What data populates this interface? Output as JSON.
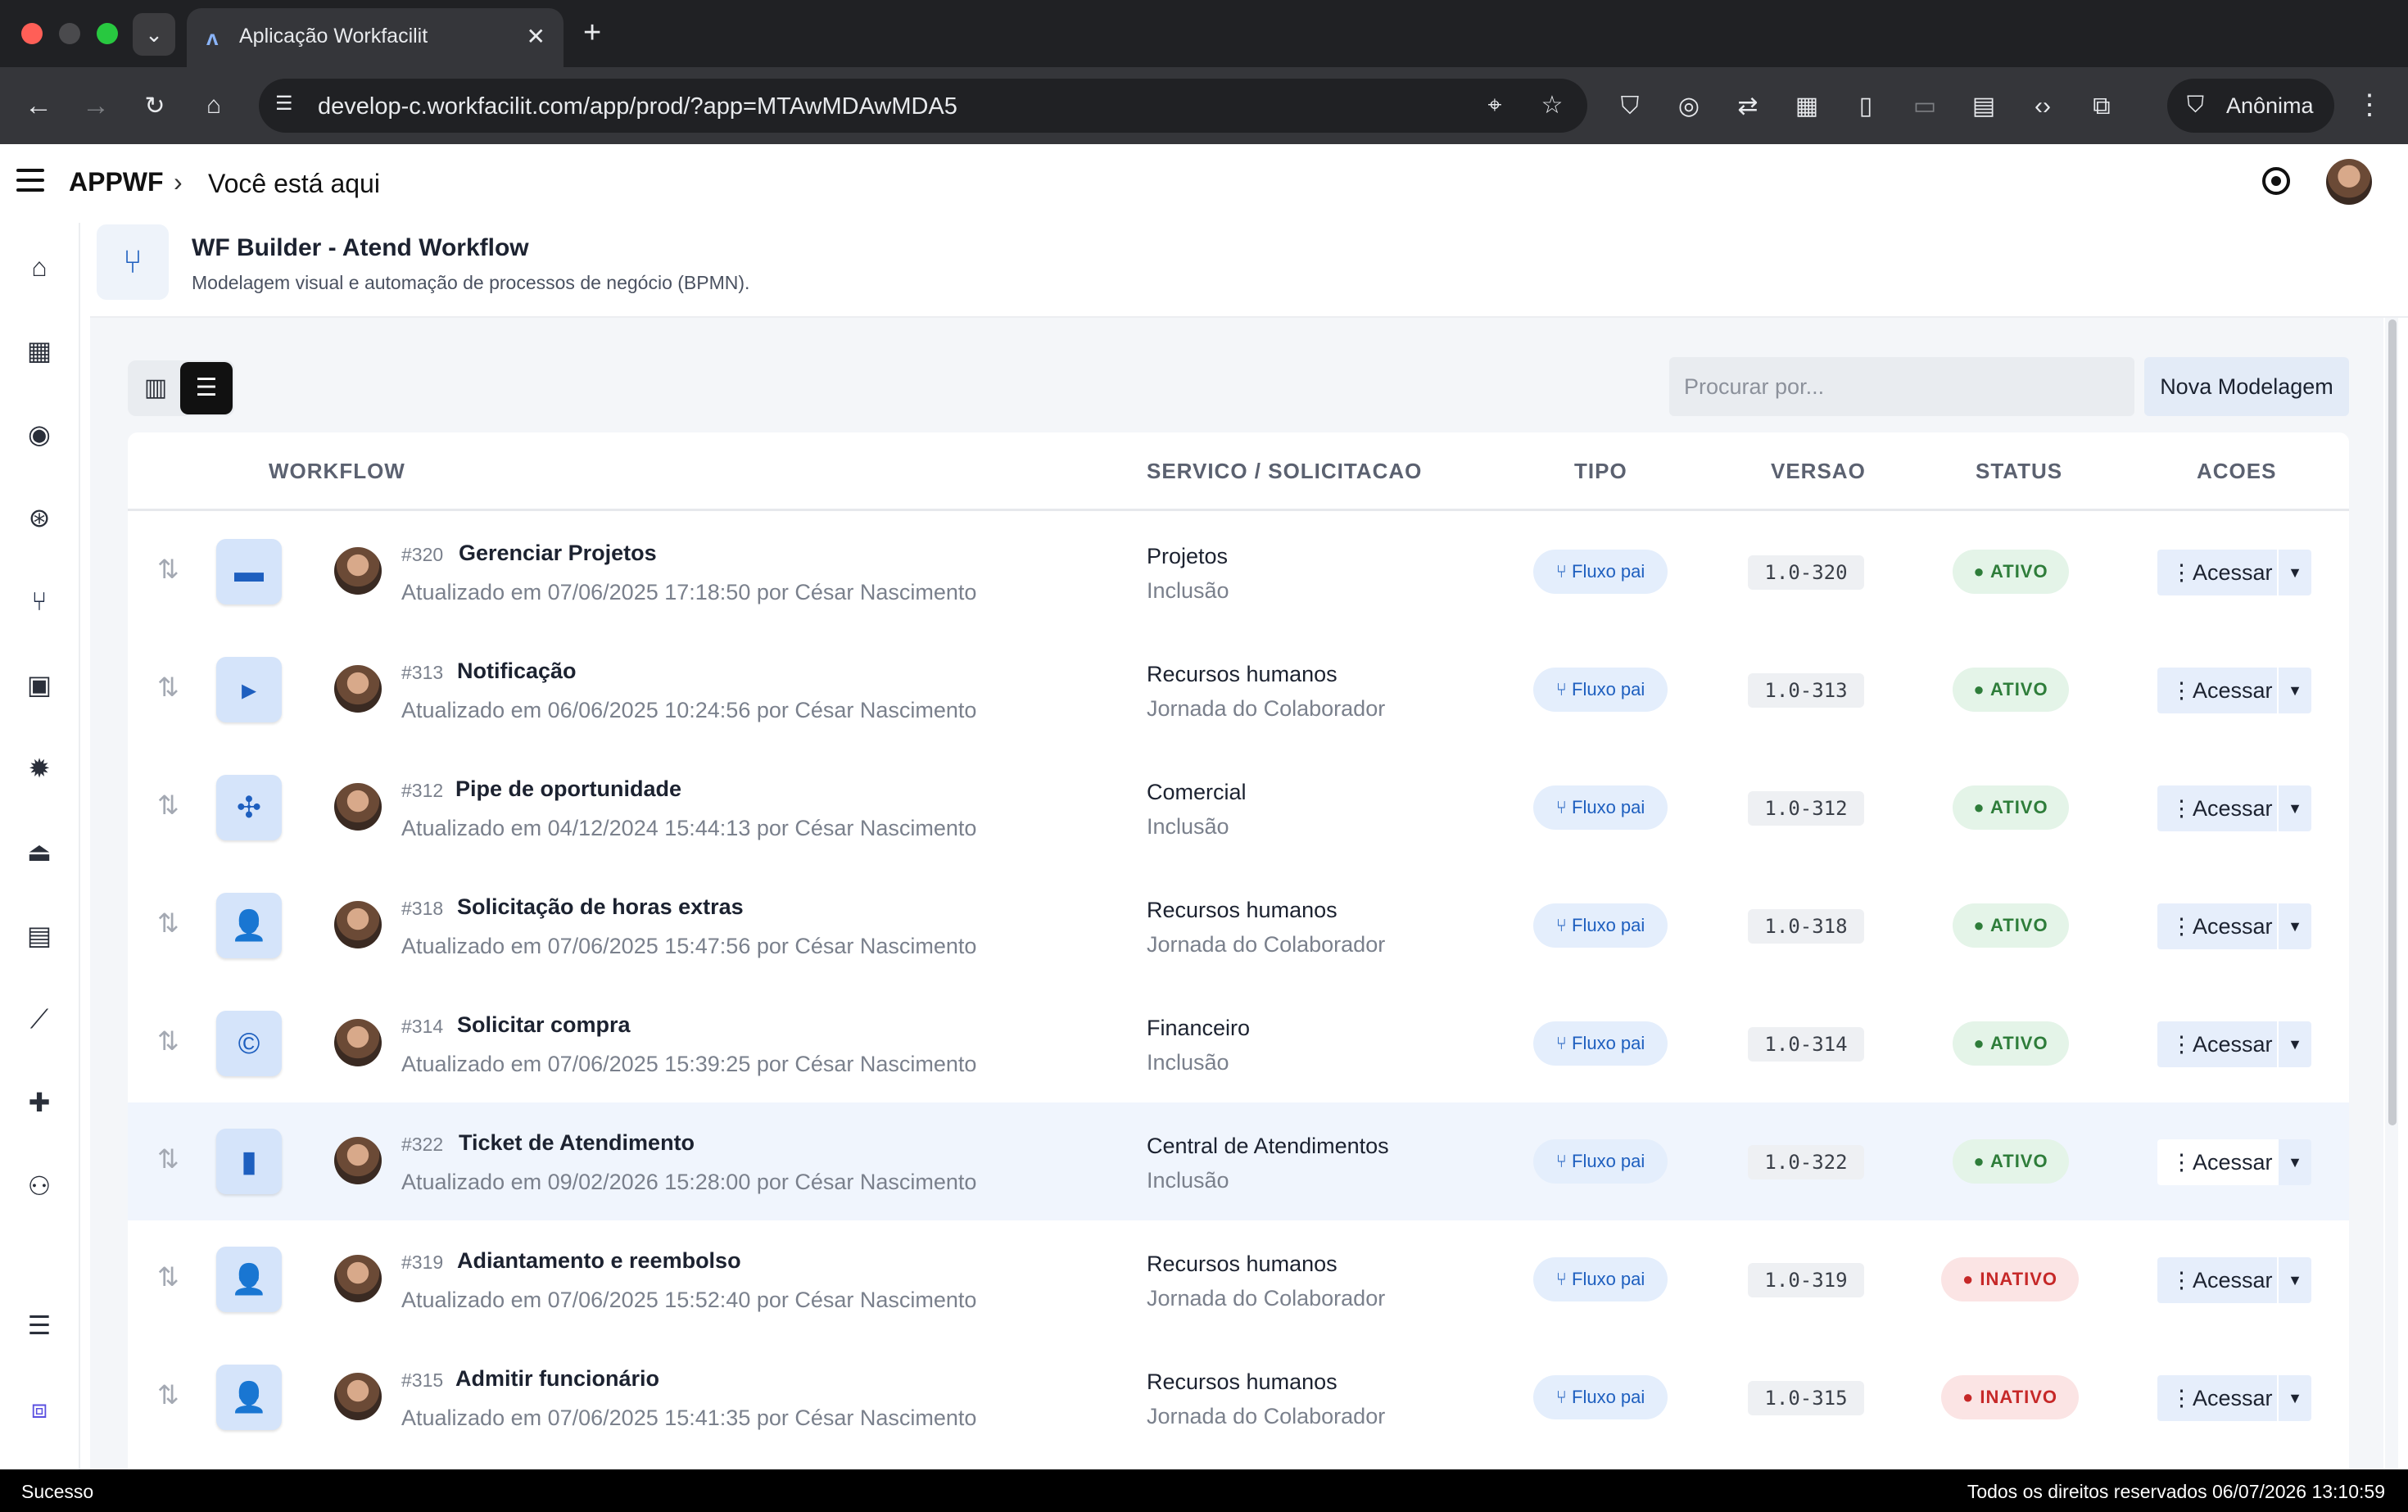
{
  "browser": {
    "tab_title": "Aplicação Workfacilit",
    "url": "develop-c.workfacilit.com/app/prod/?app=MTAwMDAwMDA5",
    "profile_label": "Anônima"
  },
  "header": {
    "brand": "APPWF",
    "breadcrumb": "Você está aqui"
  },
  "module": {
    "title": "WF Builder - Atend Workflow",
    "subtitle": "Modelagem visual e automação de processos de negócio (BPMN)."
  },
  "search": {
    "placeholder": "Procurar por..."
  },
  "new_button": "Nova Modelagem",
  "columns": {
    "workflow": "WORKFLOW",
    "servico": "SERVICO / SOLICITACAO",
    "tipo": "TIPO",
    "versao": "VERSAO",
    "status": "STATUS",
    "acoes": "ACOES"
  },
  "rows": [
    {
      "id": "#320",
      "name": "Gerenciar Projetos",
      "updated": "Atualizado em 07/06/2025 17:18:50 por César Nascimento",
      "service": "Projetos",
      "request": "Inclusão",
      "tipo": "Fluxo pai",
      "versao": "1.0-320",
      "status": "ATIVO",
      "action": "Acessar",
      "icon": "stack-icon"
    },
    {
      "id": "#313",
      "name": "Notificação",
      "updated": "Atualizado em 06/06/2025 10:24:56 por César Nascimento",
      "service": "Recursos humanos",
      "request": "Jornada do Colaborador",
      "tipo": "Fluxo pai",
      "versao": "1.0-313",
      "status": "ATIVO",
      "action": "Acessar",
      "icon": "play-box-icon"
    },
    {
      "id": "#312",
      "name": "Pipe de oportunidade",
      "updated": "Atualizado em 04/12/2024 15:44:13 por César Nascimento",
      "service": "Comercial",
      "request": "Inclusão",
      "tipo": "Fluxo pai",
      "versao": "1.0-312",
      "status": "ATIVO",
      "action": "Acessar",
      "icon": "network-icon"
    },
    {
      "id": "#318",
      "name": "Solicitação de horas extras",
      "updated": "Atualizado em 07/06/2025 15:47:56 por César Nascimento",
      "service": "Recursos humanos",
      "request": "Jornada do Colaborador",
      "tipo": "Fluxo pai",
      "versao": "1.0-318",
      "status": "ATIVO",
      "action": "Acessar",
      "icon": "user-info-icon"
    },
    {
      "id": "#314",
      "name": "Solicitar compra",
      "updated": "Atualizado em 07/06/2025 15:39:25 por César Nascimento",
      "service": "Financeiro",
      "request": "Inclusão",
      "tipo": "Fluxo pai",
      "versao": "1.0-314",
      "status": "ATIVO",
      "action": "Acessar",
      "icon": "copyright-icon"
    },
    {
      "id": "#322",
      "name": "Ticket de Atendimento",
      "updated": "Atualizado em 09/02/2026 15:28:00 por César Nascimento",
      "service": "Central de Atendimentos",
      "request": "Inclusão",
      "tipo": "Fluxo pai",
      "versao": "1.0-322",
      "status": "ATIVO",
      "action": "Acessar",
      "icon": "ticket-icon"
    },
    {
      "id": "#319",
      "name": "Adiantamento e reembolso",
      "updated": "Atualizado em 07/06/2025 15:52:40 por César Nascimento",
      "service": "Recursos humanos",
      "request": "Jornada do Colaborador",
      "tipo": "Fluxo pai",
      "versao": "1.0-319",
      "status": "INATIVO",
      "action": "Acessar",
      "icon": "user-gear-icon"
    },
    {
      "id": "#315",
      "name": "Admitir funcionário",
      "updated": "Atualizado em 07/06/2025 15:41:35 por César Nascimento",
      "service": "Recursos humanos",
      "request": "Jornada do Colaborador",
      "tipo": "Fluxo pai",
      "versao": "1.0-315",
      "status": "INATIVO",
      "action": "Acessar",
      "icon": "user-plus-icon"
    }
  ],
  "statusbar": {
    "left": "Sucesso",
    "right": "Todos os direitos reservados 06/07/2026 13:10:59"
  },
  "colors": {
    "accent_blue": "#1e5fbf",
    "status_active": "#2e7d3a",
    "status_inactive": "#c62828"
  }
}
